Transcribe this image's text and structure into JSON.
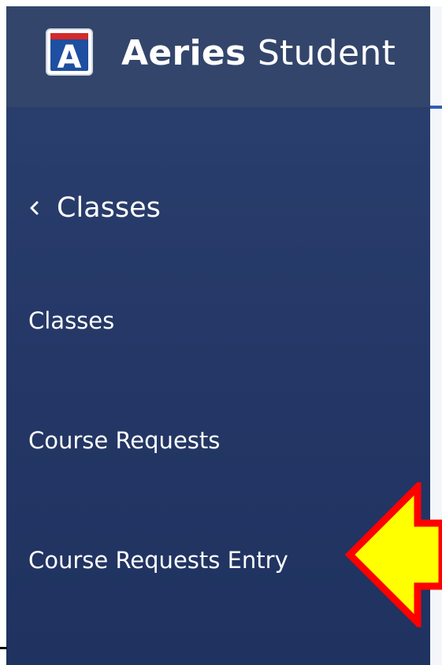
{
  "header": {
    "logo_letter": "A",
    "brand": "Aeries",
    "suffix": "Student"
  },
  "nav": {
    "back_label": "Classes",
    "items": [
      {
        "label": "Classes"
      },
      {
        "label": "Course Requests"
      },
      {
        "label": "Course Requests Entry"
      }
    ]
  },
  "annotation": {
    "arrow_icon": "left-pointing-arrow-icon",
    "arrow_fill": "#ffff00",
    "arrow_stroke": "#ff0000"
  },
  "colors": {
    "sidebar": "#2a3e6e",
    "header": "#33456b",
    "logo_blue": "#1f4fa0",
    "logo_red": "#d42a2a"
  }
}
